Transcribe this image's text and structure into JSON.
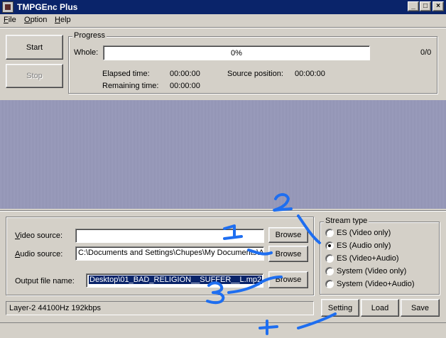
{
  "window": {
    "title": "TMPGEnc Plus",
    "controls": [
      "_",
      "□",
      "×"
    ]
  },
  "menu": [
    {
      "label": "File",
      "accel": "F",
      "rest": "ile"
    },
    {
      "label": "Option",
      "accel": "O",
      "rest": "ption"
    },
    {
      "label": "Help",
      "accel": "H",
      "rest": "elp"
    }
  ],
  "buttons": {
    "start": "Start",
    "stop": "Stop"
  },
  "progress": {
    "group_label": "Progress",
    "whole_label": "Whole:",
    "whole_value": "0%",
    "whole_fraction": 0,
    "count": "0/0",
    "elapsed_label": "Elapsed time:",
    "elapsed_value": "00:00:00",
    "remaining_label": "Remaining time:",
    "remaining_value": "00:00:00",
    "source_label": "Source position:",
    "source_value": "00:00:00"
  },
  "sources": {
    "video_label": "Video source:",
    "video_accel": "V",
    "video_rest": "ideo source:",
    "video_value": "",
    "audio_label": "Audio source:",
    "audio_accel": "A",
    "audio_rest": "udio source:",
    "audio_value": "C:\\Documents and Settings\\Chupes\\My Documents\\A",
    "output_label": "Output file name:",
    "output_value": "Desktop\\01_BAD_RELIGION__SUFFER__L.mp2",
    "browse": "Browse"
  },
  "stream_type": {
    "label": "Stream type",
    "options": [
      "ES (Video only)",
      "ES (Audio only)",
      "ES (Video+Audio)",
      "System (Video only)",
      "System (Video+Audio)"
    ],
    "selected": 1
  },
  "status": "Layer-2 44100Hz 192kbps",
  "bottom_buttons": {
    "setting": "Setting",
    "load": "Load",
    "save": "Save"
  },
  "annotations": [
    "1",
    "2",
    "3",
    "4"
  ],
  "colors": {
    "titlebar": "#0a246a",
    "face": "#d4d0c8",
    "preview": "#9a9ab4",
    "annotation": "#1e6ef0"
  }
}
